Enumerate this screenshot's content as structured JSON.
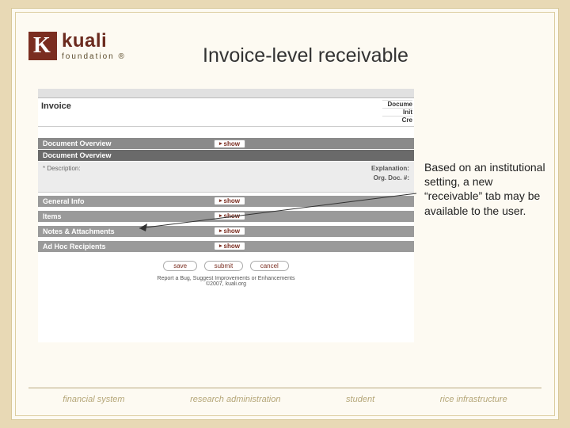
{
  "logo": {
    "brand": "kuali",
    "sub": "foundation ®"
  },
  "title": "Invoice-level receivable",
  "callout": "Based on an institutional setting, a new “receivable” tab may be available to the user.",
  "screenshot": {
    "header_title": "Invoice",
    "top_right": [
      "Docume",
      "Init",
      "Cre"
    ],
    "sections": {
      "doc_overview_outer": "Document Overview",
      "doc_overview_inner": "Document Overview",
      "description_label": "Description:",
      "explanation_label": "Explanation:",
      "orgdoc_label": "Org. Doc. #:",
      "general_info": "General Info",
      "items": "Items",
      "notes": "Notes & Attachments",
      "adhoc": "Ad Hoc Recipients"
    },
    "show_label": "show",
    "buttons": {
      "save": "save",
      "submit": "submit",
      "cancel": "cancel"
    },
    "footer_line1": "Report a Bug, Suggest Improvements or Enhancements",
    "footer_line2": "©2007, kuali.org"
  },
  "footer_links": {
    "l1": "financial system",
    "l2": "research administration",
    "l3": "student",
    "l4": "rice infrastructure"
  }
}
